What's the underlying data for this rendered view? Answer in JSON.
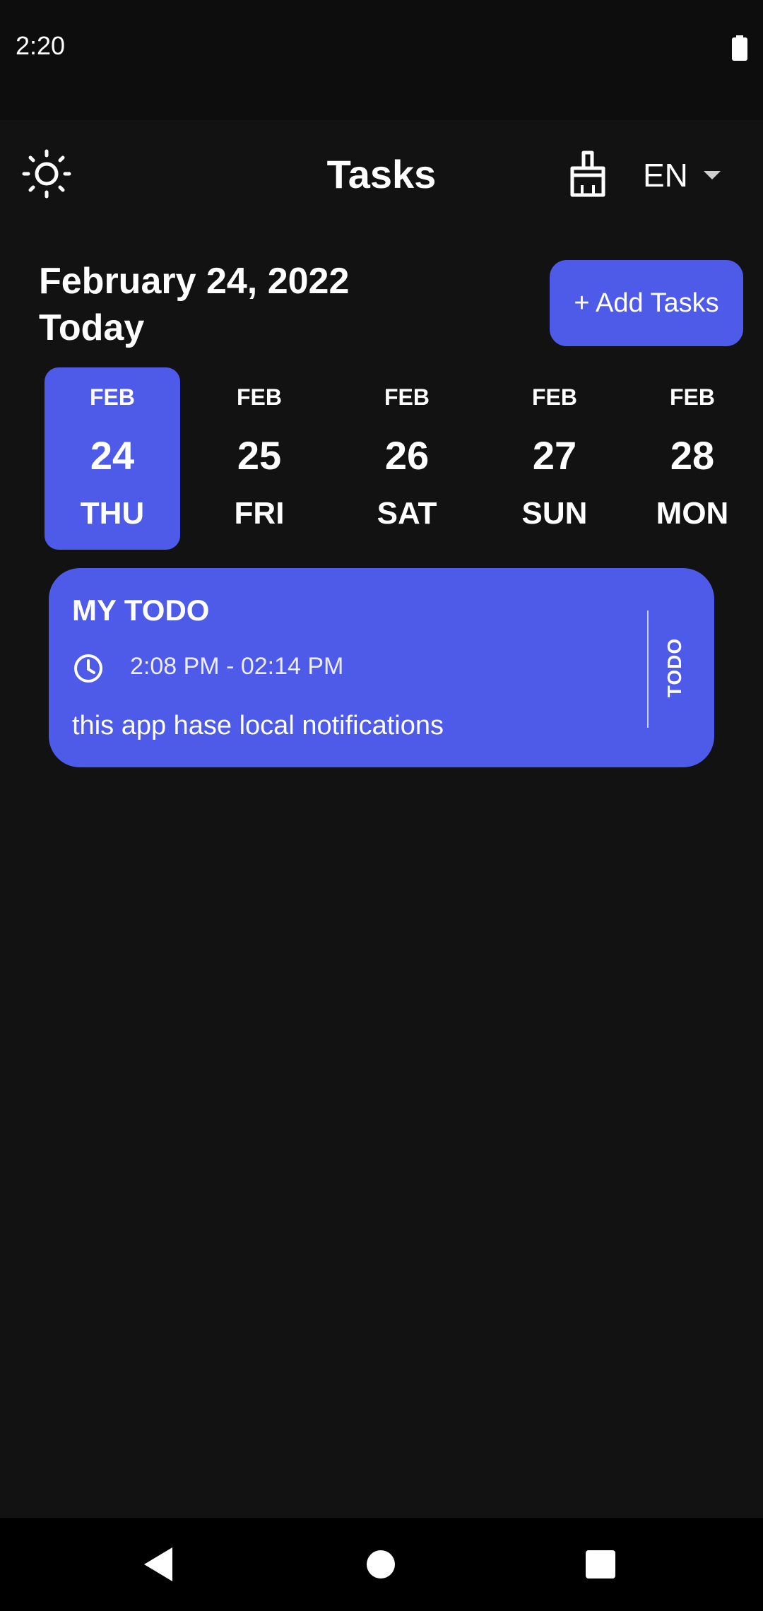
{
  "status_bar": {
    "time": "2:20",
    "battery_icon": "battery-full-icon"
  },
  "app_bar": {
    "title": "Tasks",
    "theme_icon": "sun-icon",
    "clean_icon": "broom-icon",
    "language": "EN"
  },
  "header": {
    "date": "February 24, 2022",
    "today_label": "Today",
    "add_button_label": "+ Add Tasks"
  },
  "date_picker": {
    "selected_index": 0,
    "days": [
      {
        "month": "FEB",
        "day": "24",
        "weekday": "THU"
      },
      {
        "month": "FEB",
        "day": "25",
        "weekday": "FRI"
      },
      {
        "month": "FEB",
        "day": "26",
        "weekday": "SAT"
      },
      {
        "month": "FEB",
        "day": "27",
        "weekday": "SUN"
      },
      {
        "month": "FEB",
        "day": "28",
        "weekday": "MON"
      }
    ]
  },
  "tasks": [
    {
      "title": "MY TODO",
      "time": "2:08 PM - 02:14 PM",
      "note": "this app hase local notifications",
      "status": "TODO",
      "color": "#4e5ae8"
    }
  ],
  "colors": {
    "accent": "#4e5ae8",
    "background": "#121212"
  },
  "nav_bar": {
    "back_icon": "back-triangle-icon",
    "home_icon": "home-circle-icon",
    "recents_icon": "recents-square-icon"
  }
}
